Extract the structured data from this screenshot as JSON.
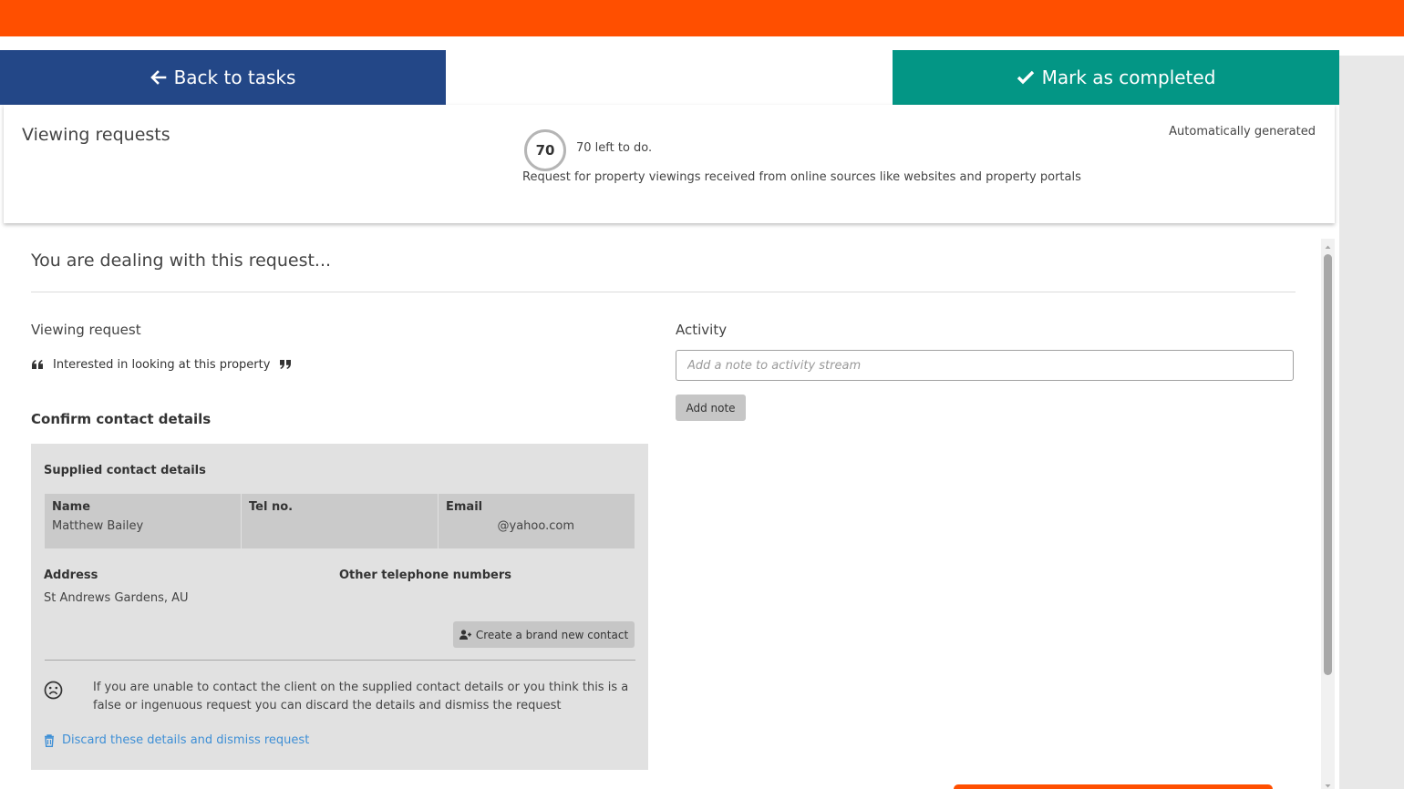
{
  "header": {
    "back_label": "Back to tasks",
    "complete_label": "Mark as completed",
    "colors": {
      "top_bar": "#ff4f00",
      "back": "#234787",
      "complete": "#039685"
    }
  },
  "summary": {
    "title": "Viewing requests",
    "count": "70",
    "count_text": "70 left to do.",
    "description": "Request for property viewings received from online sources like websites and property portals",
    "auto_label": "Automatically generated"
  },
  "main": {
    "title": "You are dealing with this request...",
    "viewing_label": "Viewing request",
    "quote": "Interested in looking at this property",
    "confirm_title": "Confirm contact details",
    "contact": {
      "supplied_title": "Supplied contact details",
      "columns": [
        {
          "header": "Name",
          "value": "Matthew Bailey"
        },
        {
          "header": "Tel no.",
          "value": ""
        },
        {
          "header": "Email",
          "value": "@yahoo.com"
        }
      ],
      "address_label": "Address",
      "address_value": "St Andrews Gardens, AU",
      "other_tel_label": "Other telephone numbers",
      "new_contact_label": "Create a brand new contact",
      "warning": "If you are unable to contact the client on the supplied contact details or you think this is a false or ingenuous request you can discard the details and dismiss the request",
      "discard_label": "Discard these details and dismiss request"
    },
    "activity": {
      "label": "Activity",
      "placeholder": "Add a note to activity stream",
      "value": "",
      "add_label": "Add note"
    }
  },
  "icons": {
    "back": "arrow-left-icon",
    "complete": "check-icon",
    "quote_open": "quote-open-icon",
    "quote_close": "quote-close-icon",
    "new_contact": "user-plus-icon",
    "sad": "sad-face-icon",
    "discard": "trash-icon"
  }
}
